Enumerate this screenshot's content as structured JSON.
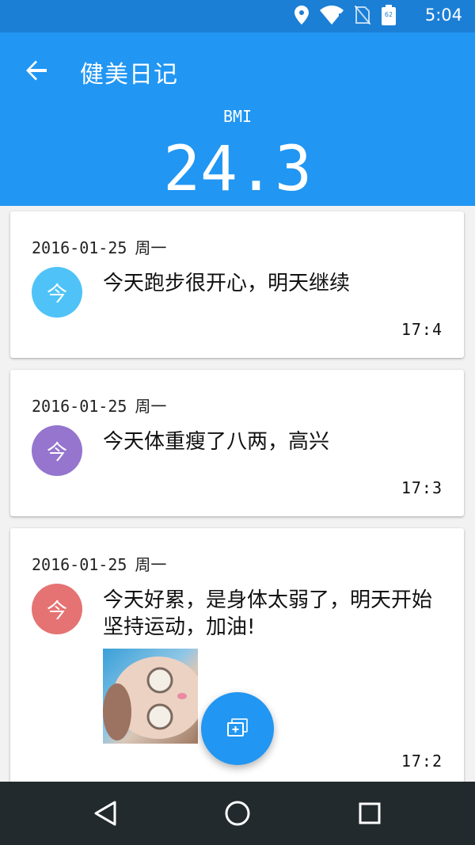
{
  "status_bar": {
    "time": "5:04",
    "battery_level": "62",
    "icons": [
      "location-icon",
      "wifi-icon",
      "no-sim-icon",
      "battery-icon"
    ]
  },
  "app_bar": {
    "title": "健美日记",
    "bmi_label": "BMI",
    "bmi_value": "24.3",
    "color": "#2196f3"
  },
  "entries": [
    {
      "date": "2016-01-25",
      "weekday": "周一",
      "avatar_char": "今",
      "avatar_color": "#4fc3f7",
      "text": "今天跑步很开心，明天继续",
      "time": "17:4",
      "has_image": false
    },
    {
      "date": "2016-01-25",
      "weekday": "周一",
      "avatar_char": "今",
      "avatar_color": "#9575cd",
      "text": "今天体重瘦了八两，高兴",
      "time": "17:3",
      "has_image": false
    },
    {
      "date": "2016-01-25",
      "weekday": "周一",
      "avatar_char": "今",
      "avatar_color": "#e57373",
      "text": "今天好累，是身体太弱了，明天开始坚持运动，加油!",
      "time": "17:2",
      "has_image": true
    }
  ],
  "fab": {
    "icon": "add-photos-icon"
  },
  "nav_bar": {
    "icons": [
      "back-triangle-icon",
      "home-circle-icon",
      "recents-square-icon"
    ]
  }
}
